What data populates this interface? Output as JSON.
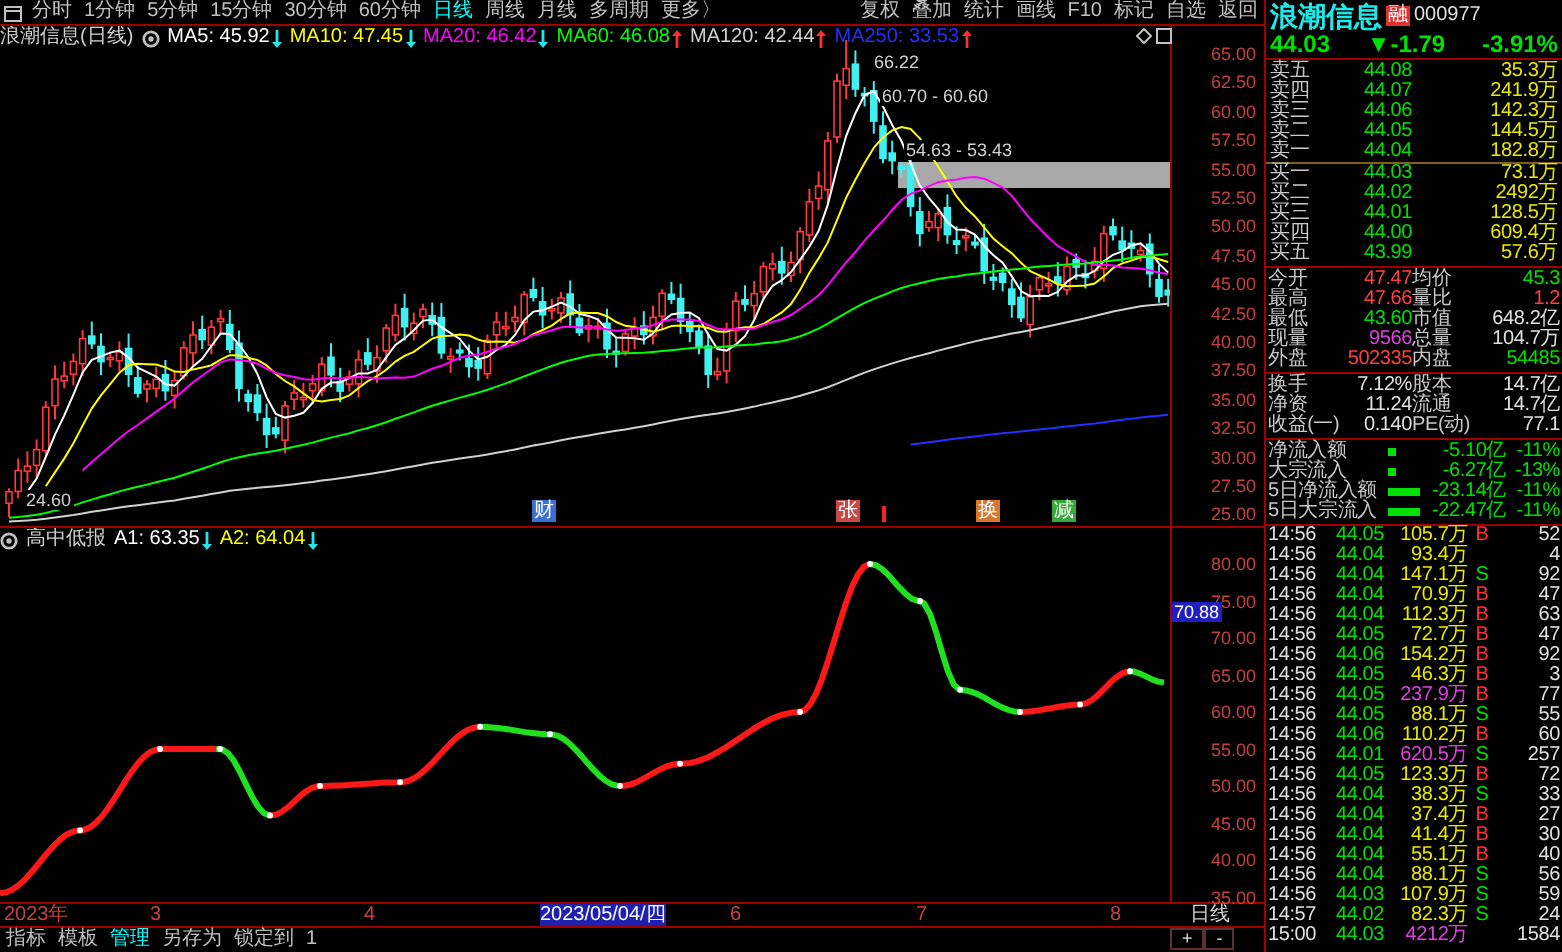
{
  "toolbar": {
    "periods": [
      {
        "label": "分时",
        "selected": false
      },
      {
        "label": "1分钟",
        "selected": false
      },
      {
        "label": "5分钟",
        "selected": false
      },
      {
        "label": "15分钟",
        "selected": false
      },
      {
        "label": "30分钟",
        "selected": false
      },
      {
        "label": "60分钟",
        "selected": false
      },
      {
        "label": "日线",
        "selected": true
      },
      {
        "label": "周线",
        "selected": false
      },
      {
        "label": "月线",
        "selected": false
      },
      {
        "label": "多周期",
        "selected": false
      },
      {
        "label": "更多〉",
        "selected": false
      }
    ],
    "tools": [
      "复权",
      "叠加",
      "统计",
      "画线",
      "F10",
      "标记",
      "自选",
      "返回"
    ]
  },
  "chart": {
    "title": "浪潮信息(日线)",
    "averages": [
      {
        "label": "MA5: 45.92",
        "rising": false,
        "color": "#ffffff"
      },
      {
        "label": "MA10: 47.45",
        "rising": false,
        "color": "#ffff00"
      },
      {
        "label": "MA20: 46.42",
        "rising": false,
        "color": "#ff00ff"
      },
      {
        "label": "MA60: 46.08",
        "rising": true,
        "color": "#00ff00"
      },
      {
        "label": "MA120: 42.44",
        "rising": true,
        "color": "#d0d0d0"
      },
      {
        "label": "MA250: 33.53",
        "rising": true,
        "color": "#2030ff"
      }
    ],
    "annotations": [
      "66.22",
      "60.70 - 60.60",
      "54.63 - 53.43",
      "24.60"
    ],
    "events": [
      {
        "label": "财",
        "color": "#3a6fd0"
      },
      {
        "label": "张",
        "color": "#c84848"
      },
      {
        "label": "换",
        "color": "#d8782a"
      },
      {
        "label": "减",
        "color": "#38a838"
      }
    ],
    "price_axis": [
      "65.00",
      "62.50",
      "60.00",
      "57.50",
      "55.00",
      "52.50",
      "50.00",
      "47.50",
      "45.00",
      "42.50",
      "40.00",
      "37.50",
      "35.00",
      "32.50",
      "30.00",
      "27.50",
      "25.00"
    ]
  },
  "indicator": {
    "name": "高中低报",
    "values": [
      {
        "label": "A1: 63.35",
        "rising": false,
        "color": "#ffffff"
      },
      {
        "label": "A2: 64.04",
        "rising": false,
        "color": "#ffff00"
      }
    ],
    "axis": [
      "80.00",
      "75.00",
      "70.00",
      "65.00",
      "60.00",
      "55.00",
      "50.00",
      "45.00",
      "40.00",
      "35.00"
    ],
    "cursor_value": "70.88"
  },
  "date_axis": [
    {
      "label": "2023年",
      "selected": false
    },
    {
      "label": "3",
      "selected": false
    },
    {
      "label": "4",
      "selected": false
    },
    {
      "label": "2023/05/04/四",
      "selected": true
    },
    {
      "label": "6",
      "selected": false
    },
    {
      "label": "7",
      "selected": false
    },
    {
      "label": "8",
      "selected": false
    }
  ],
  "bottom_tabs": [
    {
      "label": "指标",
      "selected": false
    },
    {
      "label": "模板",
      "selected": false
    },
    {
      "label": "管理",
      "selected": true
    },
    {
      "label": "另存为",
      "selected": false
    },
    {
      "label": "锁定到",
      "selected": false
    },
    {
      "label": "1",
      "selected": false
    }
  ],
  "period_box": {
    "label": "日线",
    "buttons": [
      "+",
      "-"
    ]
  },
  "quote": {
    "name": "浪潮信息",
    "badge": "融",
    "code": "000977",
    "price": "44.03",
    "change": "▼-1.79",
    "change_pct": "-3.91%",
    "order_book": [
      {
        "label": "卖五",
        "price": "44.08",
        "volume": "35.3万"
      },
      {
        "label": "卖四",
        "price": "44.07",
        "volume": "241.9万"
      },
      {
        "label": "卖三",
        "price": "44.06",
        "volume": "142.3万"
      },
      {
        "label": "卖二",
        "price": "44.05",
        "volume": "144.5万"
      },
      {
        "label": "卖一",
        "price": "44.04",
        "volume": "182.8万"
      },
      {
        "label": "买一",
        "price": "44.03",
        "volume": "73.1万"
      },
      {
        "label": "买二",
        "price": "44.02",
        "volume": "2492万"
      },
      {
        "label": "买三",
        "price": "44.01",
        "volume": "128.5万"
      },
      {
        "label": "买四",
        "price": "44.00",
        "volume": "609.4万"
      },
      {
        "label": "买五",
        "price": "43.99",
        "volume": "57.6万"
      }
    ],
    "stats": [
      {
        "cells": [
          {
            "label": "今开",
            "value": "47.47",
            "color": "#ff4040"
          },
          {
            "label": "均价",
            "value": "45.3",
            "color": "#00e000"
          }
        ]
      },
      {
        "cells": [
          {
            "label": "最高",
            "value": "47.66",
            "color": "#ff4040"
          },
          {
            "label": "量比",
            "value": "1.2",
            "color": "#ff4040"
          }
        ]
      },
      {
        "cells": [
          {
            "label": "最低",
            "value": "43.60",
            "color": "#00e000"
          },
          {
            "label": "市值",
            "value": "648.2亿",
            "color": "#e0e0e0"
          }
        ]
      },
      {
        "cells": [
          {
            "label": "现量",
            "value": "9566",
            "color": "#e040e0"
          },
          {
            "label": "总量",
            "value": "104.7万",
            "color": "#e0e0e0"
          }
        ]
      },
      {
        "cells": [
          {
            "label": "外盘",
            "value": "502335",
            "color": "#ff4040"
          },
          {
            "label": "内盘",
            "value": "54485",
            "color": "#00e000"
          }
        ]
      }
    ],
    "capital": [
      {
        "cells": [
          {
            "label": "换手",
            "value": "7.12%"
          },
          {
            "label": "股本",
            "value": "14.7亿"
          }
        ]
      },
      {
        "cells": [
          {
            "label": "净资",
            "value": "11.24"
          },
          {
            "label": "流通",
            "value": "14.7亿"
          }
        ]
      },
      {
        "cells": [
          {
            "label": "收益(一)",
            "value": "0.140"
          },
          {
            "label": "PE(动)",
            "value": "77.1"
          }
        ]
      }
    ],
    "flows": [
      {
        "label": "净流入额",
        "kind": "square",
        "value": "-5.10亿",
        "percent": "-11%"
      },
      {
        "label": "大宗流入",
        "kind": "square",
        "value": "-6.27亿",
        "percent": "-13%"
      },
      {
        "label": "5日净流入额",
        "kind": "wide",
        "value": "-23.14亿",
        "percent": "-11%"
      },
      {
        "label": "5日大宗流入",
        "kind": "wide",
        "value": "-22.47亿",
        "percent": "-11%"
      }
    ],
    "ticks": [
      {
        "time": "14:56",
        "price": "44.05",
        "volume": "105.7万",
        "large": false,
        "side": "B",
        "color": "#ff3030",
        "count": "52"
      },
      {
        "time": "14:56",
        "price": "44.04",
        "volume": "93.4万",
        "large": false,
        "count": "4"
      },
      {
        "time": "14:56",
        "price": "44.04",
        "volume": "147.1万",
        "large": false,
        "side": "S",
        "color": "#00e000",
        "count": "92"
      },
      {
        "time": "14:56",
        "price": "44.04",
        "volume": "70.9万",
        "large": false,
        "side": "B",
        "color": "#ff3030",
        "count": "47"
      },
      {
        "time": "14:56",
        "price": "44.04",
        "volume": "112.3万",
        "large": false,
        "side": "B",
        "color": "#ff3030",
        "count": "63"
      },
      {
        "time": "14:56",
        "price": "44.05",
        "volume": "72.7万",
        "large": false,
        "side": "B",
        "color": "#ff3030",
        "count": "47"
      },
      {
        "time": "14:56",
        "price": "44.06",
        "volume": "154.2万",
        "large": false,
        "side": "B",
        "color": "#ff3030",
        "count": "92"
      },
      {
        "time": "14:56",
        "price": "44.05",
        "volume": "46.3万",
        "large": false,
        "side": "B",
        "color": "#ff3030",
        "count": "3"
      },
      {
        "time": "14:56",
        "price": "44.05",
        "volume": "237.9万",
        "large": true,
        "side": "B",
        "color": "#ff3030",
        "count": "77"
      },
      {
        "time": "14:56",
        "price": "44.05",
        "volume": "88.1万",
        "large": false,
        "side": "S",
        "color": "#00e000",
        "count": "55"
      },
      {
        "time": "14:56",
        "price": "44.06",
        "volume": "110.2万",
        "large": false,
        "side": "B",
        "color": "#ff3030",
        "count": "60"
      },
      {
        "time": "14:56",
        "price": "44.01",
        "volume": "620.5万",
        "large": true,
        "side": "S",
        "color": "#00e000",
        "count": "257"
      },
      {
        "time": "14:56",
        "price": "44.05",
        "volume": "123.3万",
        "large": false,
        "side": "B",
        "color": "#ff3030",
        "count": "72"
      },
      {
        "time": "14:56",
        "price": "44.04",
        "volume": "38.3万",
        "large": false,
        "side": "S",
        "color": "#00e000",
        "count": "33"
      },
      {
        "time": "14:56",
        "price": "44.04",
        "volume": "37.4万",
        "large": false,
        "side": "B",
        "color": "#ff3030",
        "count": "27"
      },
      {
        "time": "14:56",
        "price": "44.04",
        "volume": "41.4万",
        "large": false,
        "side": "B",
        "color": "#ff3030",
        "count": "30"
      },
      {
        "time": "14:56",
        "price": "44.04",
        "volume": "55.1万",
        "large": false,
        "side": "B",
        "color": "#ff3030",
        "count": "40"
      },
      {
        "time": "14:56",
        "price": "44.04",
        "volume": "88.1万",
        "large": false,
        "side": "S",
        "color": "#00e000",
        "count": "56"
      },
      {
        "time": "14:56",
        "price": "44.03",
        "volume": "107.9万",
        "large": false,
        "side": "S",
        "color": "#00e000",
        "count": "59"
      },
      {
        "time": "14:57",
        "price": "44.02",
        "volume": "82.3万",
        "large": false,
        "side": "S",
        "color": "#00e000",
        "count": "24"
      },
      {
        "time": "15:00",
        "price": "44.03",
        "volume": "4212万",
        "large": true,
        "count": "1584"
      }
    ]
  }
}
